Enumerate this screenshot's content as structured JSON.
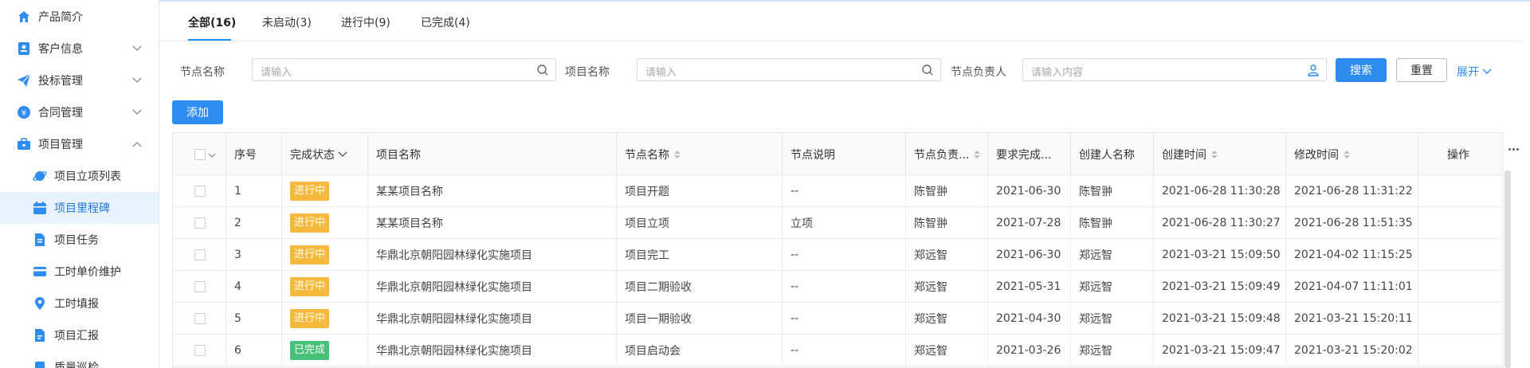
{
  "sidebar": {
    "items": [
      {
        "label": "产品简介",
        "icon": "home-icon"
      },
      {
        "label": "客户信息",
        "icon": "contact-card-icon"
      },
      {
        "label": "投标管理",
        "icon": "paper-plane-icon"
      },
      {
        "label": "合同管理",
        "icon": "yen-circle-icon"
      },
      {
        "label": "项目管理",
        "icon": "briefcase-icon"
      }
    ],
    "subitems": [
      {
        "label": "项目立项列表",
        "icon": "planet-icon"
      },
      {
        "label": "项目里程碑",
        "icon": "calendar-icon"
      },
      {
        "label": "项目任务",
        "icon": "document-icon"
      },
      {
        "label": "工时单价维护",
        "icon": "card-icon"
      },
      {
        "label": "工时填报",
        "icon": "location-pin-icon"
      },
      {
        "label": "项目汇报",
        "icon": "report-icon"
      },
      {
        "label": "质量巡检",
        "icon": "inspection-icon"
      }
    ]
  },
  "tabs": [
    {
      "label": "全部(16)"
    },
    {
      "label": "未启动(3)"
    },
    {
      "label": "进行中(9)"
    },
    {
      "label": "已完成(4)"
    }
  ],
  "filters": {
    "node_name_label": "节点名称",
    "node_name_placeholder": "请输入",
    "project_name_label": "项目名称",
    "project_name_placeholder": "请输入",
    "owner_label": "节点负责人",
    "owner_placeholder": "请输入内容",
    "search_label": "搜索",
    "reset_label": "重置",
    "expand_label": "展开"
  },
  "add_label": "添加",
  "table": {
    "headers": {
      "seq": "序号",
      "status": "完成状态",
      "project": "项目名称",
      "node": "节点名称",
      "desc": "节点说明",
      "owner": "节点负责...",
      "due": "要求完成...",
      "creator": "创建人名称",
      "created": "创建时间",
      "modified": "修改时间",
      "ops": "操作"
    },
    "rows": [
      {
        "seq": "1",
        "status": "进行中",
        "project": "某某项目名称",
        "node": "项目开题",
        "desc": "--",
        "owner": "陈智翀",
        "due": "2021-06-30",
        "creator": "陈智翀",
        "created": "2021-06-28 11:30:28",
        "modified": "2021-06-28 11:31:22"
      },
      {
        "seq": "2",
        "status": "进行中",
        "project": "某某项目名称",
        "node": "项目立项",
        "desc": "立项",
        "owner": "陈智翀",
        "due": "2021-07-28",
        "creator": "陈智翀",
        "created": "2021-06-28 11:30:27",
        "modified": "2021-06-28 11:51:35"
      },
      {
        "seq": "3",
        "status": "进行中",
        "project": "华鼎北京朝阳园林绿化实施项目",
        "node": "项目完工",
        "desc": "--",
        "owner": "郑远智",
        "due": "2021-06-30",
        "creator": "郑远智",
        "created": "2021-03-21 15:09:50",
        "modified": "2021-04-02 11:15:25"
      },
      {
        "seq": "4",
        "status": "进行中",
        "project": "华鼎北京朝阳园林绿化实施项目",
        "node": "项目二期验收",
        "desc": "--",
        "owner": "郑远智",
        "due": "2021-05-31",
        "creator": "郑远智",
        "created": "2021-03-21 15:09:49",
        "modified": "2021-04-07 11:11:01"
      },
      {
        "seq": "5",
        "status": "进行中",
        "project": "华鼎北京朝阳园林绿化实施项目",
        "node": "项目一期验收",
        "desc": "--",
        "owner": "郑远智",
        "due": "2021-04-30",
        "creator": "郑远智",
        "created": "2021-03-21 15:09:48",
        "modified": "2021-03-21 15:20:11"
      },
      {
        "seq": "6",
        "status": "已完成",
        "project": "华鼎北京朝阳园林绿化实施项目",
        "node": "项目启动会",
        "desc": "--",
        "owner": "郑远智",
        "due": "2021-03-26",
        "creator": "郑远智",
        "created": "2021-03-21 15:09:47",
        "modified": "2021-03-21 15:20:02"
      }
    ]
  },
  "colors": {
    "accent": "#2f8cf0",
    "in_progress": "#f5b93b",
    "done": "#47c17a"
  }
}
